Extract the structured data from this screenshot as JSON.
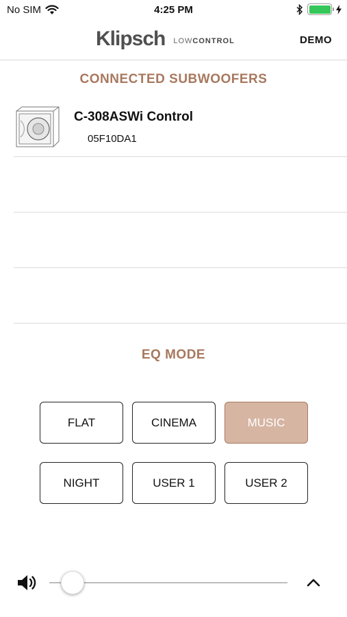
{
  "status_bar": {
    "carrier": "No SIM",
    "time": "4:25 PM",
    "battery_level": 1.0
  },
  "header": {
    "brand": "Klipsch",
    "subtitle_light": "LOW",
    "subtitle_bold": "CONTROL",
    "demo_label": "DEMO"
  },
  "subwoofers": {
    "title": "CONNECTED SUBWOOFERS",
    "items": [
      {
        "name": "C-308ASWi Control",
        "id": "05F10DA1"
      }
    ]
  },
  "eq": {
    "title": "EQ MODE",
    "modes": [
      "FLAT",
      "CINEMA",
      "MUSIC",
      "NIGHT",
      "USER 1",
      "USER 2"
    ],
    "active": "MUSIC"
  },
  "volume": {
    "level": 0.05
  },
  "colors": {
    "accent": "#a8785e",
    "active_fill": "#d6b5a3"
  }
}
